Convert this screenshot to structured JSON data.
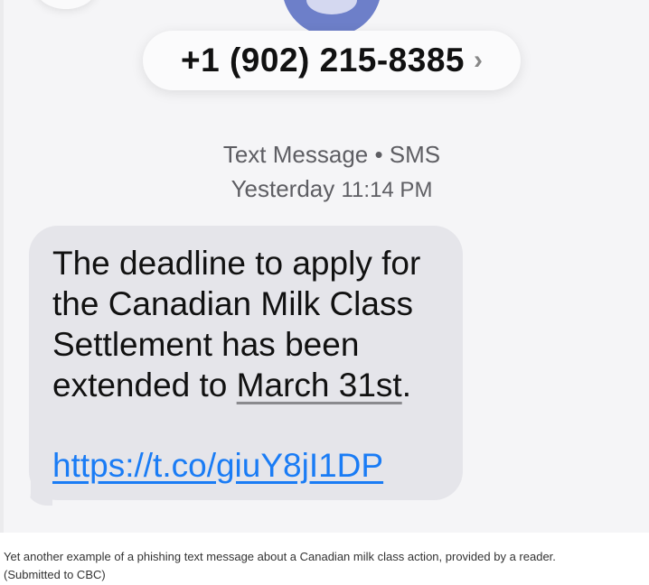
{
  "header": {
    "phone_number": "+1 (902) 215-8385",
    "chevron": "›",
    "icons": [
      "back-icon",
      "contact-avatar-icon"
    ]
  },
  "meta": {
    "type": "Text Message • SMS",
    "time_label": "Yesterday",
    "time_value": "11:14 PM"
  },
  "message": {
    "lines": [
      "The deadline to apply for",
      "the Canadian Milk Class",
      "Settlement has been",
      "extended to"
    ],
    "date_link": "March 31st",
    "period": ".",
    "url": "https://t.co/giuY8jI1DP"
  },
  "caption": {
    "line1": "Yet another example of a phishing text message about a Canadian milk class action, provided by a reader.",
    "line2": "(Submitted to CBC)"
  },
  "colors": {
    "bubble": "#e5e5ea",
    "link": "#1a7cf5",
    "avatar": "#6d7fc9"
  }
}
